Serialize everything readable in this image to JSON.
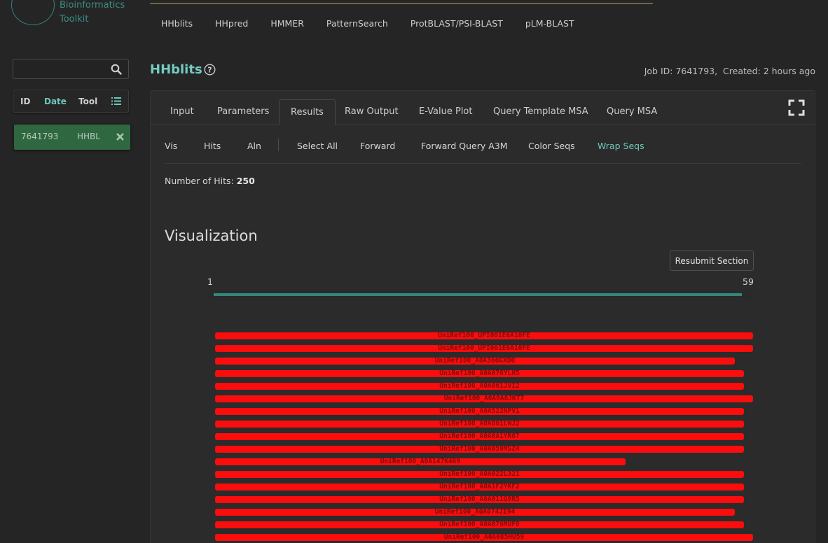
{
  "logo": {
    "line1": "Bioinformatics",
    "line2": "Toolkit"
  },
  "topnav": [
    "HHblits",
    "HHpred",
    "HMMER",
    "PatternSearch",
    "ProtBLAST/PSI-BLAST",
    "pLM-BLAST"
  ],
  "sidebar": {
    "search": {
      "value": "",
      "placeholder": ""
    },
    "columns": {
      "id": "ID",
      "date": "Date",
      "tool": "Tool"
    },
    "job": {
      "id": "7641793",
      "tool": "HHBL"
    }
  },
  "header": {
    "title": "HHblits",
    "job_id": "Job ID: 7641793,",
    "created": "Created: 2 hours ago"
  },
  "tabs": [
    "Input",
    "Parameters",
    "Results",
    "Raw Output",
    "E-Value Plot",
    "Query Template MSA",
    "Query MSA"
  ],
  "active_tab": "Results",
  "subnav": [
    "Vis",
    "Hits",
    "Aln",
    "Select All",
    "Forward",
    "Forward Query A3M",
    "Color Seqs",
    "Wrap Seqs"
  ],
  "results": {
    "hits_label": "Number of Hits:",
    "hits_value": "250",
    "vis_title": "Visualization",
    "resubmit": "Resubmit Section",
    "range_start": "1",
    "range_end": "59"
  },
  "colors": {
    "accent": "#74cbc1",
    "hit_bar": "#fb0d0d",
    "job_active": "#2e6740",
    "slider": "#33867c"
  },
  "hits": [
    {
      "label": "UniRef100_UPI001E6A10FE",
      "start": 1,
      "end": 59
    },
    {
      "label": "UniRef100_UPI001E6A10FE",
      "start": 1,
      "end": 59
    },
    {
      "label": "UniRef100_A0A366GXD0",
      "start": 1,
      "end": 57
    },
    {
      "label": "UniRef100_A0A076YLH5",
      "start": 1,
      "end": 58
    },
    {
      "label": "UniRef100_A0A061JVI2",
      "start": 1,
      "end": 58
    },
    {
      "label": "UniRef100_A0A0A8JKT7",
      "start": 1,
      "end": 59
    },
    {
      "label": "UniRef100_A0A522NPV1",
      "start": 1,
      "end": 58
    },
    {
      "label": "UniRef100_A0A061LWJ2",
      "start": 1,
      "end": 58
    },
    {
      "label": "UniRef100_A0A0A1YR67",
      "start": 1,
      "end": 58
    },
    {
      "label": "UniRef100_A0A059MSZ4",
      "start": 1,
      "end": 58
    },
    {
      "label": "UniRef100_A0A147K469",
      "start": 1,
      "end": 45
    },
    {
      "label": "UniRef100_A0A022L321",
      "start": 1,
      "end": 58
    },
    {
      "label": "UniRef100_A0A1F2YKF2",
      "start": 1,
      "end": 58
    },
    {
      "label": "UniRef100_A0A011Q9R5",
      "start": 1,
      "end": 58
    },
    {
      "label": "UniRef100_A0A074JI94",
      "start": 1,
      "end": 57
    },
    {
      "label": "UniRef100_A0A076MUF0",
      "start": 1,
      "end": 58
    },
    {
      "label": "UniRef100_A0A085HU59",
      "start": 1,
      "end": 59
    }
  ]
}
